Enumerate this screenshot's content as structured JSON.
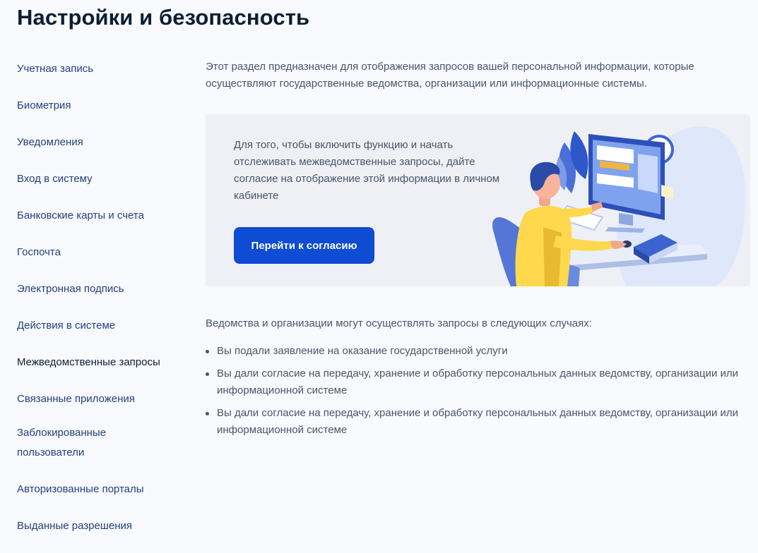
{
  "page_title": "Настройки и безопасность",
  "sidebar": {
    "items": [
      {
        "label": "Учетная запись",
        "active": false
      },
      {
        "label": "Биометрия",
        "active": false
      },
      {
        "label": "Уведомления",
        "active": false
      },
      {
        "label": "Вход в систему",
        "active": false
      },
      {
        "label": "Банковские карты и счета",
        "active": false
      },
      {
        "label": "Госпочта",
        "active": false
      },
      {
        "label": "Электронная подпись",
        "active": false
      },
      {
        "label": "Действия в системе",
        "active": false
      },
      {
        "label": "Межведомственные запросы",
        "active": true
      },
      {
        "label": "Связанные приложения",
        "active": false
      },
      {
        "label": "Заблокированные пользователи",
        "active": false
      },
      {
        "label": "Авторизованные порталы",
        "active": false
      },
      {
        "label": "Выданные разрешения",
        "active": false
      }
    ]
  },
  "main": {
    "intro": "Этот раздел предназначен для отображения запросов вашей персональной информации, которые осуществляют государственные ведомства, организации или информационные системы.",
    "banner": {
      "text": "Для того, чтобы включить функцию и начать отслеживать межведомственные запросы, дайте согласие на отображение этой информации в личном кабинете",
      "button_label": "Перейти к согласию",
      "illustration": "person-at-computer-illustration"
    },
    "lead": "Ведомства и организации могут осуществлять запросы в следующих случаях:",
    "cases": [
      "Вы подали заявление на оказание государственной услуги",
      "Вы дали согласие на передачу, хранение и обработку персональных данных ведомству, организации или информационной системе",
      "Вы дали согласие на передачу, хранение и обработку персональных данных ведомству, организации или информационной системе"
    ]
  },
  "colors": {
    "accent": "#0d4cd3",
    "link": "#214080",
    "text_primary": "#0b1f33",
    "text_secondary": "#4a5468",
    "banner_bg": "#eef0f5",
    "page_bg": "#f9fafd"
  }
}
